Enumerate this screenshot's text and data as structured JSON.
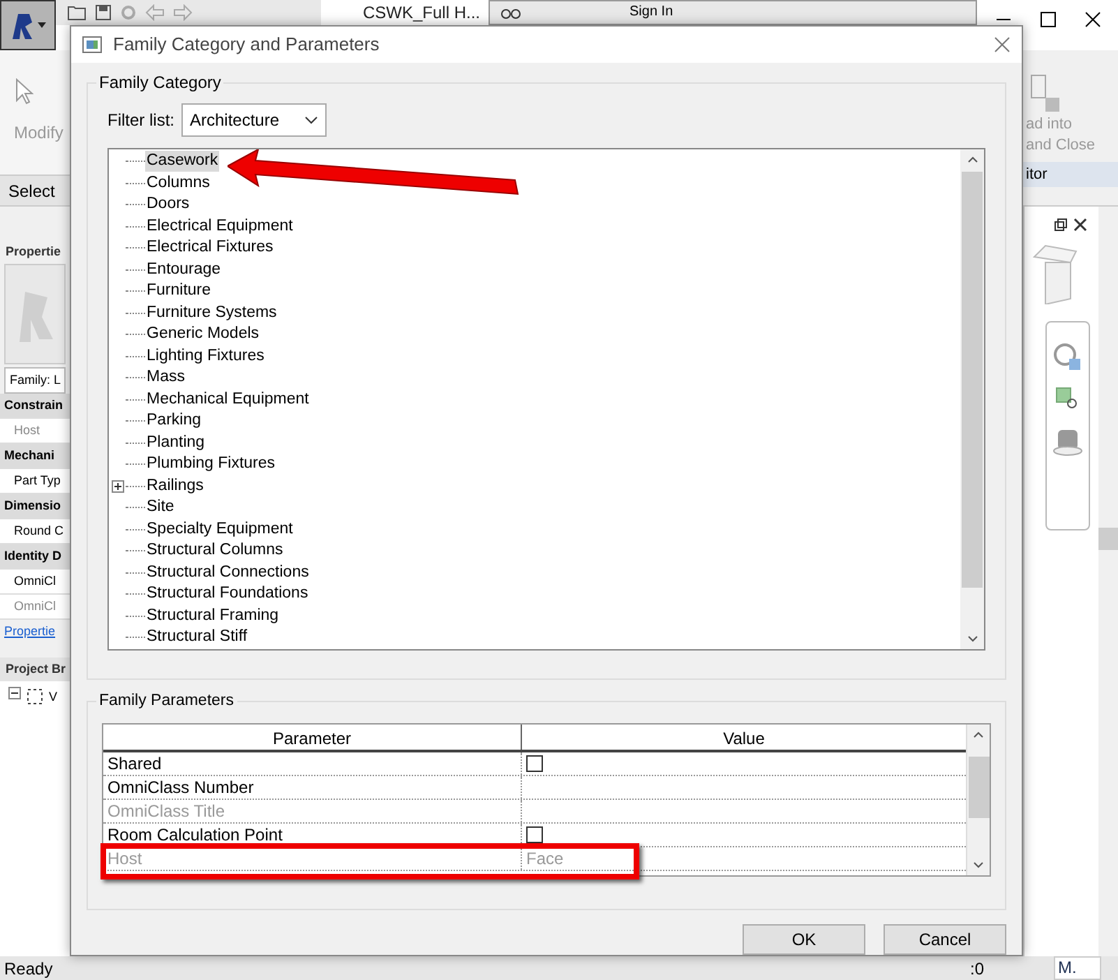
{
  "app": {
    "title": "CSWK_Full H...",
    "sign_in": "Sign In",
    "ribbon_left": {
      "modify": "Modify",
      "select": "Select"
    },
    "ribbon_right": {
      "line_1": "ad into",
      "line_2": "and Close",
      "panel": "itor"
    },
    "properties": {
      "header": "Propertie",
      "family": "Family: L",
      "rows": [
        {
          "text": "Constrain",
          "kind": "group"
        },
        {
          "text": "Host",
          "kind": "muted"
        },
        {
          "text": "Mechani",
          "kind": "group"
        },
        {
          "text": "Part Typ",
          "kind": "item"
        },
        {
          "text": "Dimensio",
          "kind": "group"
        },
        {
          "text": "Round C",
          "kind": "item"
        },
        {
          "text": "Identity D",
          "kind": "group"
        },
        {
          "text": "OmniCl",
          "kind": "item"
        },
        {
          "text": "OmniCl",
          "kind": "muted"
        }
      ],
      "link": "Propertie"
    },
    "browser": {
      "header": "Project Br",
      "root": "V"
    },
    "status": {
      "ready": "Ready",
      "count": ":0",
      "model": "M."
    }
  },
  "dialog": {
    "title": "Family Category and Parameters",
    "category_group": "Family Category",
    "filter_label": "Filter list:",
    "filter_value": "Architecture",
    "tree": [
      {
        "label": "Casework",
        "selected": true,
        "expandable": false
      },
      {
        "label": "Columns",
        "selected": false,
        "expandable": false
      },
      {
        "label": "Doors",
        "selected": false,
        "expandable": false
      },
      {
        "label": "Electrical Equipment",
        "selected": false,
        "expandable": false
      },
      {
        "label": "Electrical Fixtures",
        "selected": false,
        "expandable": false
      },
      {
        "label": "Entourage",
        "selected": false,
        "expandable": false
      },
      {
        "label": "Furniture",
        "selected": false,
        "expandable": false
      },
      {
        "label": "Furniture Systems",
        "selected": false,
        "expandable": false
      },
      {
        "label": "Generic Models",
        "selected": false,
        "expandable": false
      },
      {
        "label": "Lighting Fixtures",
        "selected": false,
        "expandable": false
      },
      {
        "label": "Mass",
        "selected": false,
        "expandable": false
      },
      {
        "label": "Mechanical Equipment",
        "selected": false,
        "expandable": false
      },
      {
        "label": "Parking",
        "selected": false,
        "expandable": false
      },
      {
        "label": "Planting",
        "selected": false,
        "expandable": false
      },
      {
        "label": "Plumbing Fixtures",
        "selected": false,
        "expandable": false
      },
      {
        "label": "Railings",
        "selected": false,
        "expandable": true
      },
      {
        "label": "Site",
        "selected": false,
        "expandable": false
      },
      {
        "label": "Specialty Equipment",
        "selected": false,
        "expandable": false
      },
      {
        "label": "Structural Columns",
        "selected": false,
        "expandable": false
      },
      {
        "label": "Structural Connections",
        "selected": false,
        "expandable": false
      },
      {
        "label": "Structural Foundations",
        "selected": false,
        "expandable": false
      },
      {
        "label": "Structural Framing",
        "selected": false,
        "expandable": false
      },
      {
        "label": "Structural Stiff",
        "selected": false,
        "expandable": false
      }
    ],
    "parameters_group": "Family Parameters",
    "columns": [
      "Parameter",
      "Value"
    ],
    "rows": [
      {
        "parameter": "Shared",
        "kind": "checkbox",
        "checked": false,
        "disabled": false
      },
      {
        "parameter": "OmniClass Number",
        "kind": "text",
        "disabled": false
      },
      {
        "parameter": "OmniClass Title",
        "kind": "text",
        "disabled": true
      },
      {
        "parameter": "Room Calculation Point",
        "kind": "checkbox",
        "checked": false,
        "disabled": false
      },
      {
        "parameter": "Host",
        "kind": "text",
        "value": "Face",
        "disabled": true
      }
    ],
    "buttons": [
      "OK",
      "Cancel"
    ]
  }
}
